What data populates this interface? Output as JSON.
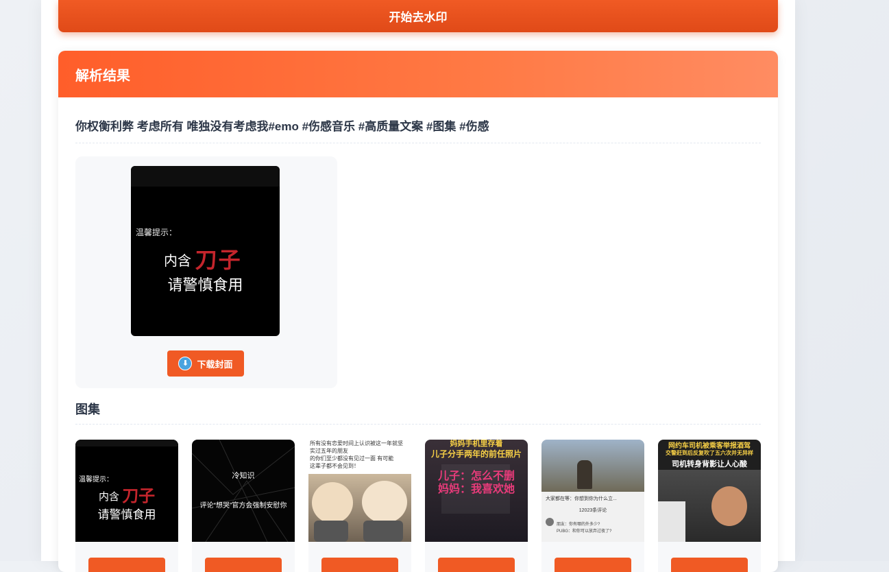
{
  "actions": {
    "start_label": "开始去水印"
  },
  "result": {
    "header": "解析结果",
    "title": "你权衡利弊 考虑所有 唯独没有考虑我#emo #伤感音乐 #高质量文案 #图集 #伤感",
    "cover": {
      "tip": "温馨提示：",
      "line1_prefix": "内含",
      "line1_red": "刀子",
      "line2": "请警慎食用",
      "download_label": "下载封面",
      "download_icon": "download-circle-icon"
    },
    "gallery": {
      "title": "图集",
      "items": [
        {
          "tip": "温馨提示：",
          "line1_prefix": "内含",
          "line1_red": "刀子",
          "line2": "请警慎食用"
        },
        {
          "line1": "冷知识",
          "line2": "评论“想哭”官方会强制安慰你"
        },
        {
          "lines": [
            "所有没有恋爱时间上认识被这一年就坚",
            "实过五年的朋友",
            "的你们至少都没有见过一面 有可能",
            "这辈子都不会见到！"
          ]
        },
        {
          "line1": "妈妈手机里存着",
          "line2": "儿子分手两年的前任照片",
          "line3": "儿子：怎么不删",
          "line4": "妈妈：我喜欢她"
        },
        {
          "caption": "大家都在等：你想到你为什么立...",
          "comments": "12023条评论",
          "reply1": "朋友：你有哪的外多少?",
          "reply2": "PUBG：和你可以放弃过夜了?"
        },
        {
          "line1": "网约车司机被乘客举报酒驾",
          "line2": "交警赶到后反复吹了五六次并无异样",
          "line3": "司机转身背影让人心酸"
        }
      ]
    }
  },
  "colors": {
    "accent": "#f05a24",
    "header_start": "#ff5e2a",
    "header_end": "#ff8c62"
  }
}
